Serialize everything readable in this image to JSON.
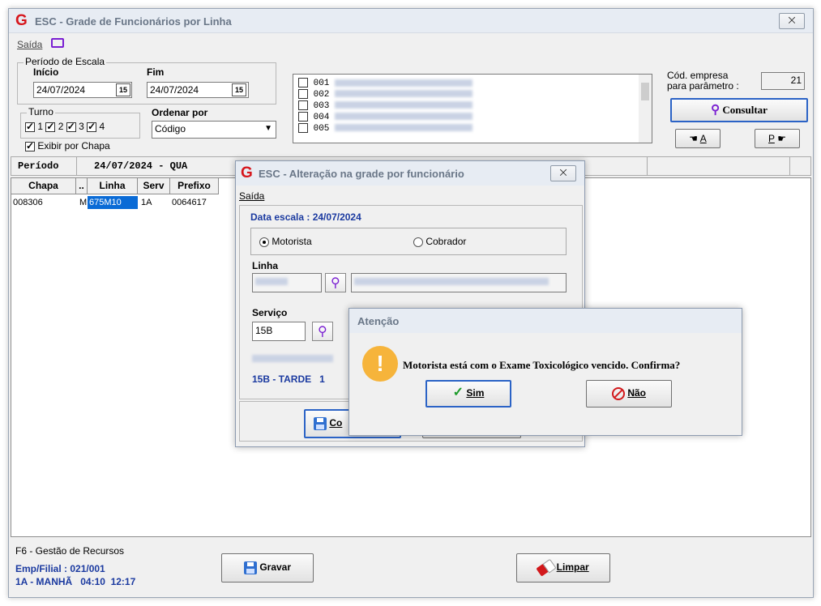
{
  "main_window": {
    "title": "ESC - Grade de Funcionários por Linha",
    "close_glyph": "⨉",
    "menu": {
      "saida": "Saída"
    },
    "periodo": {
      "group_label": "Período de Escala",
      "inicio_label": "Início",
      "inicio_value": "24/07/2024",
      "fim_label": "Fim",
      "fim_value": "24/07/2024",
      "cal_glyph": "15"
    },
    "turno": {
      "group_label": "Turno",
      "items": [
        {
          "label": "1",
          "checked": true
        },
        {
          "label": "2",
          "checked": true
        },
        {
          "label": "3",
          "checked": true
        },
        {
          "label": "4",
          "checked": true
        }
      ]
    },
    "ordenar": {
      "label": "Ordenar por",
      "value": "Código"
    },
    "exibir_chapa": {
      "label": "Exibir por Chapa",
      "checked": true
    },
    "linhas_list": [
      "001",
      "002",
      "003",
      "004",
      "005"
    ],
    "cod_empresa": {
      "label_line1": "Cód. empresa",
      "label_line2": "para parâmetro :",
      "value": "21"
    },
    "consultar_button": "Consultar",
    "nav_a_label": "A",
    "nav_p_label": "P",
    "periodo_bar": {
      "label": "Período",
      "value": "24/07/2024 - QUA"
    },
    "grid": {
      "headers": [
        "Chapa",
        "..",
        "Linha",
        "Serv",
        "Prefixo"
      ],
      "rows": [
        {
          "chapa": "008306",
          "flag": "M",
          "linha": "675M10",
          "serv": "1A",
          "prefixo": "0064617"
        }
      ]
    },
    "footer": {
      "f6": "F6 - Gestão de Recursos",
      "emp": "Emp/Filial : 021/001",
      "turno_info": "1A - MANHÃ   04:10  12:17",
      "gravar_button": "Gravar",
      "limpar_button": "Limpar"
    }
  },
  "alteracao_dialog": {
    "title": "ESC - Alteração na grade por funcionário",
    "close_glyph": "⨉",
    "menu_saida": "Saída",
    "data_escala": "Data escala : 24/07/2024",
    "radio_motorista": "Motorista",
    "radio_cobrador": "Cobrador",
    "linha_label": "Linha",
    "servico_label": "Serviço",
    "servico_value": "15B",
    "servico_info": "15B - TARDE",
    "servico_info_suffix": "1",
    "confirm_button_partial": "Co"
  },
  "atencao_dialog": {
    "title": "Atenção",
    "icon_glyph": "!",
    "message": "Motorista está com o Exame Toxicológico vencido. Confirma?",
    "sim_button": "Sim",
    "nao_button": "Não"
  },
  "colors": {
    "accent": "#2b63c6",
    "brand_red": "#d2181b",
    "label_blue": "#1b3aa0",
    "selection": "#0a6bd6",
    "warning": "#f6b43b"
  }
}
